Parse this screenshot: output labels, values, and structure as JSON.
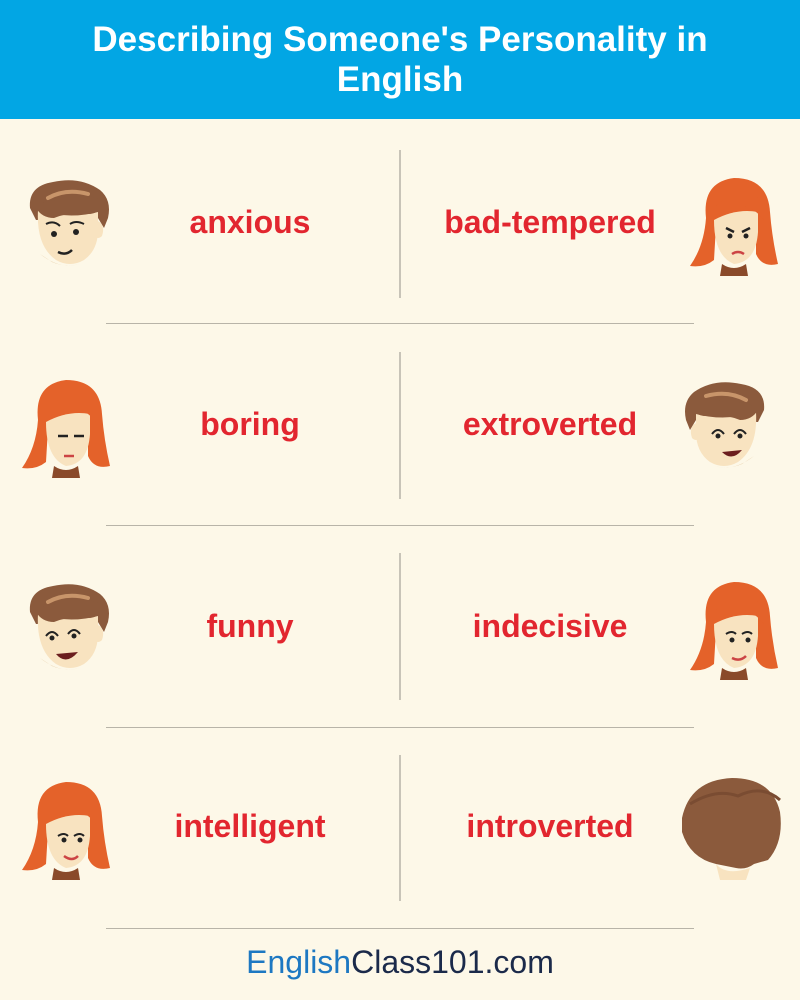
{
  "title": "Describing Someone's Personality in English",
  "rows": [
    {
      "left": {
        "word": "anxious",
        "face": "anxious-boy-face-icon"
      },
      "right": {
        "word": "bad-tempered",
        "face": "bad-tempered-girl-face-icon"
      }
    },
    {
      "left": {
        "word": "boring",
        "face": "boring-girl-face-icon"
      },
      "right": {
        "word": "extroverted",
        "face": "extroverted-boy-face-icon"
      }
    },
    {
      "left": {
        "word": "funny",
        "face": "funny-boy-face-icon"
      },
      "right": {
        "word": "indecisive",
        "face": "indecisive-girl-face-icon"
      }
    },
    {
      "left": {
        "word": "intelligent",
        "face": "intelligent-girl-face-icon"
      },
      "right": {
        "word": "introverted",
        "face": "introverted-boy-back-of-head-icon"
      }
    }
  ],
  "footer": {
    "part1": "English",
    "part2": "Class101.com"
  },
  "colors": {
    "header_bg": "#02a6e4",
    "page_bg": "#fdf8e8",
    "word": "#e2262f",
    "brand_blue": "#1d78c2",
    "brand_dark": "#1b2a4a",
    "boy_hair": "#8b5a3c",
    "girl_hair": "#e4622a",
    "skin": "#f8e3c0"
  }
}
